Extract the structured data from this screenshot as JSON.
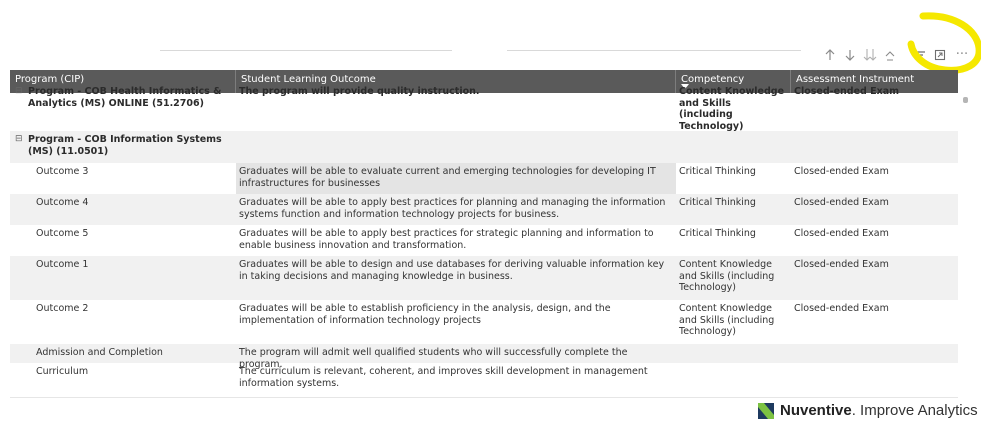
{
  "toolbar": {
    "icons": [
      "sort-ascending-icon",
      "sort-descending-icon",
      "drill-down-icon",
      "expand-hierarchy-icon",
      "filter-icon",
      "focus-mode-icon",
      "more-options-icon"
    ],
    "more_label": "···"
  },
  "table": {
    "headers": {
      "program": "Program (CIP)",
      "outcome": "Student Learning Outcome",
      "competency": "Competency",
      "instrument": "Assessment Instrument"
    },
    "partial_group": {
      "program": "Program - COB Health Informatics & Analytics (MS) ONLINE (51.2706)",
      "outcome": "The program will provide quality instruction.",
      "competency": "Content Knowledge and Skills (including Technology)",
      "instrument": "Closed-ended Exam"
    },
    "group": {
      "expand_symbol": "⊟",
      "program": "Program - COB Information Systems (MS) (11.0501)"
    },
    "rows": [
      {
        "program": "Outcome 3",
        "outcome": "Graduates will be able to evaluate current and emerging technologies for developing IT infrastructures for businesses",
        "competency": "Critical Thinking",
        "instrument": "Closed-ended Exam"
      },
      {
        "program": "Outcome 4",
        "outcome": "Graduates will be able to apply best practices for planning and managing the information systems function and information technology projects for business.",
        "competency": "Critical Thinking",
        "instrument": "Closed-ended Exam"
      },
      {
        "program": "Outcome 5",
        "outcome": "Graduates will be able to apply best practices for strategic planning and information to enable business innovation and transformation.",
        "competency": "Critical Thinking",
        "instrument": "Closed-ended Exam"
      },
      {
        "program": "Outcome 1",
        "outcome": "Graduates will be able to design and use databases for deriving valuable information key in taking decisions and managing knowledge in business.",
        "competency": "Content Knowledge and Skills (including Technology)",
        "instrument": "Closed-ended Exam"
      },
      {
        "program": "Outcome 2",
        "outcome": "Graduates will be able to establish proficiency in the analysis, design, and the implementation of information technology projects",
        "competency": "Content Knowledge and Skills (including Technology)",
        "instrument": "Closed-ended Exam"
      },
      {
        "program": "Admission and Completion",
        "outcome": "The program will admit well qualified students who will successfully complete the program.",
        "competency": "",
        "instrument": ""
      },
      {
        "program": "Curriculum",
        "outcome": "The curriculum is relevant, coherent, and improves skill development in management information systems.",
        "competency": "",
        "instrument": ""
      }
    ]
  },
  "footer": {
    "brand_bold": "Nuventive",
    "brand_rest": ". Improve Analytics",
    "logo_colors": [
      "#1e3a5f",
      "#7cc242"
    ]
  },
  "colors": {
    "header_bg": "#5a5a5a",
    "alt_row": "#f1f1f1",
    "highlight": "#f5e800"
  }
}
